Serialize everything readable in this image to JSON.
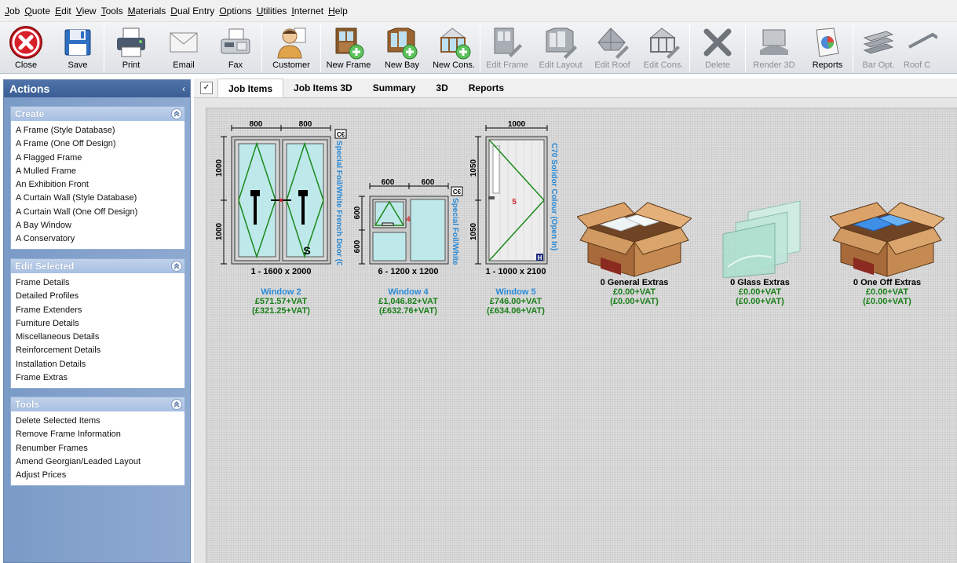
{
  "menu": [
    "Job",
    "Quote",
    "Edit",
    "View",
    "Tools",
    "Materials",
    "Dual Entry",
    "Options",
    "Utilities",
    "Internet",
    "Help"
  ],
  "toolbar": {
    "buttons": [
      {
        "label": "Close",
        "icon": "close-icon"
      },
      {
        "label": "Save",
        "icon": "save-icon"
      },
      {
        "label": "Print",
        "icon": "printer-icon"
      },
      {
        "label": "Email",
        "icon": "email-icon"
      },
      {
        "label": "Fax",
        "icon": "fax-icon"
      },
      {
        "label": "Customer",
        "icon": "customer-icon"
      },
      {
        "label": "New Frame",
        "icon": "new-frame-icon"
      },
      {
        "label": "New Bay",
        "icon": "new-bay-icon"
      },
      {
        "label": "New Cons.",
        "icon": "new-conservatory-icon"
      },
      {
        "label": "Edit Frame",
        "icon": "edit-frame-icon"
      },
      {
        "label": "Edit Layout",
        "icon": "edit-layout-icon"
      },
      {
        "label": "Edit Roof",
        "icon": "edit-roof-icon"
      },
      {
        "label": "Edit Cons.",
        "icon": "edit-conservatory-icon"
      },
      {
        "label": "Delete",
        "icon": "delete-icon"
      },
      {
        "label": "Render 3D",
        "icon": "render-3d-icon"
      },
      {
        "label": "Reports",
        "icon": "reports-icon"
      },
      {
        "label": "Bar Opt.",
        "icon": "bar-optimise-icon"
      },
      {
        "label": "Roof C",
        "icon": "roof-icon"
      }
    ]
  },
  "actions": {
    "title": "Actions",
    "collapse_glyph": "‹",
    "groups": {
      "create": {
        "title": "Create",
        "items": [
          "A Frame (Style Database)",
          "A Frame (One Off Design)",
          "A Flagged Frame",
          "A Mulled Frame",
          "An Exhibition Front",
          "A Curtain Wall (Style Database)",
          "A Curtain Wall (One Off Design)",
          "A Bay Window",
          "A Conservatory"
        ]
      },
      "edit_selected": {
        "title": "Edit Selected",
        "items": [
          "Frame Details",
          "Detailed Profiles",
          "Frame Extenders",
          "Furniture Details",
          "Miscellaneous Details",
          "Reinforcement Details",
          "Installation Details",
          "Frame Extras"
        ]
      },
      "tools": {
        "title": "Tools",
        "items": [
          "Delete Selected Items",
          "Remove Frame Information",
          "Renumber Frames",
          "Amend Georgian/Leaded Layout",
          "Adjust Prices"
        ]
      }
    }
  },
  "tabs": {
    "check_glyph": "✓",
    "items": [
      "Job Items",
      "Job Items 3D",
      "Summary",
      "3D",
      "Reports"
    ],
    "active": "Job Items"
  },
  "job_items": [
    {
      "size": "1 - 1600 x 2000",
      "name": "Window 2",
      "price": "£571.57+VAT",
      "price_ex": "(£321.25+VAT)",
      "dims": {
        "top_left": "800",
        "top_right": "800",
        "left_top": "1000",
        "left_bottom": "1000"
      },
      "side_text": "Special Foil/White French Door (O",
      "mark": "S",
      "badge": "C€"
    },
    {
      "size": "6 - 1200 x 1200",
      "name": "Window 4",
      "price": "£1,046.82+VAT",
      "price_ex": "(£632.76+VAT)",
      "dims": {
        "top_left": "600",
        "top_right": "600",
        "left_top": "600",
        "left_bottom": "600"
      },
      "side_text": "Special Foil/White Ca",
      "mark": "4",
      "badge": "C€"
    },
    {
      "size": "1 - 1000 x 2100",
      "name": "Window 5",
      "price": "£746.00+VAT",
      "price_ex": "(£634.06+VAT)",
      "dims": {
        "top": "1000",
        "left_top": "1050",
        "left_bottom": "1050"
      },
      "side_text": "C70 Solidor Colour (Open In)",
      "mark": "5",
      "badge": "H"
    }
  ],
  "extras": [
    {
      "label": "0 General Extras",
      "price": "£0.00+VAT",
      "price_ex": "(£0.00+VAT)",
      "icon": "general-extras-box-icon"
    },
    {
      "label": "0 Glass Extras",
      "price": "£0.00+VAT",
      "price_ex": "(£0.00+VAT)",
      "icon": "glass-panes-icon"
    },
    {
      "label": "0 One Off Extras",
      "price": "£0.00+VAT",
      "price_ex": "(£0.00+VAT)",
      "icon": "one-off-extras-box-icon"
    }
  ],
  "colors": {
    "accent_blue": "#2a8ad6",
    "price_green": "#1a7f1a",
    "panel_blue": "#3b5e93",
    "glass": "#bfe8ea",
    "frame_line": "#1b8a1b"
  }
}
